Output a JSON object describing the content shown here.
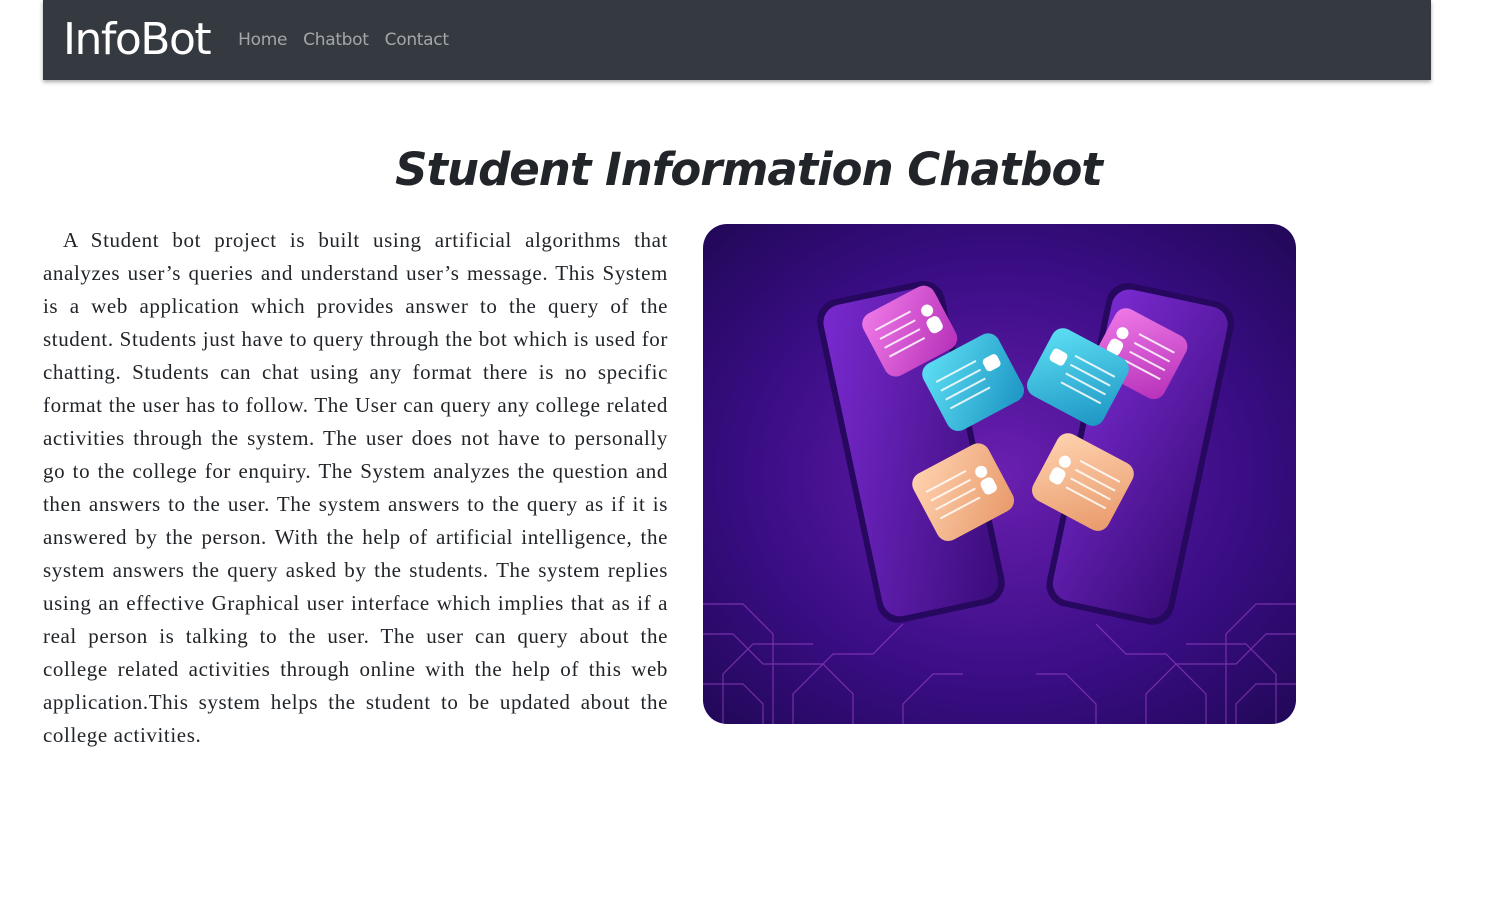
{
  "navbar": {
    "brand": "InfoBot",
    "links": [
      {
        "label": "Home"
      },
      {
        "label": "Chatbot"
      },
      {
        "label": "Contact"
      }
    ],
    "background": "#343a40"
  },
  "main": {
    "title": "Student Information Chatbot",
    "description": "A Student bot project is built using artificial algorithms that analyzes user’s queries and understand user’s message. This System is a web application which provides answer to the query of the student. Students just have to query through the bot which is used for chatting. Students can chat using any format there is no specific format the user has to follow. The User can query any college related activities through the system. The user does not have to personally go to the college for enquiry. The System analyzes the question and then answers to the user. The system answers to the query as if it is answered by the person. With the help of artificial intelligence, the system answers the query asked by the students. The system replies using an effective Graphical user interface which implies that as if a real person is talking to the user. The user can query about the college related activities through online with the help of this web application.This system helps the student to be updated about the college activities.",
    "hero_image": {
      "icon": "chatbot-illustration",
      "colors": {
        "background_dark": "#1d0750",
        "background_light": "#6a1fb0",
        "bubble_pink": "#d94fd6",
        "bubble_cyan": "#2fc0de",
        "bubble_peach": "#f7b98c"
      }
    }
  }
}
